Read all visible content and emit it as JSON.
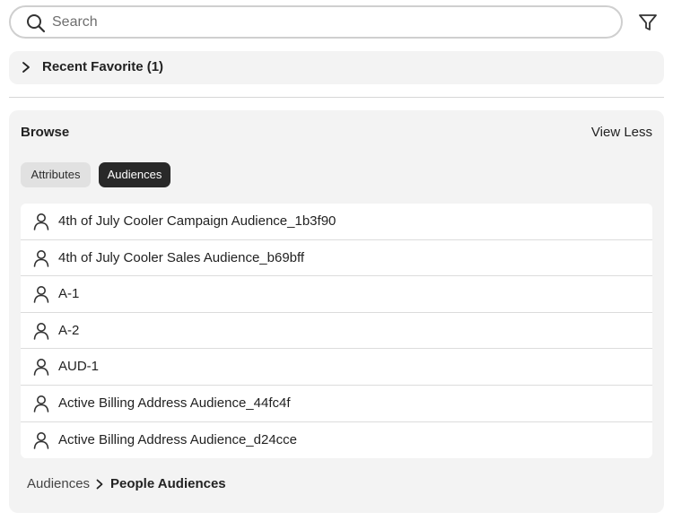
{
  "search": {
    "placeholder": "Search",
    "value": "",
    "icon": "search-icon"
  },
  "filter": {
    "icon": "filter-icon"
  },
  "recent": {
    "label": "Recent Favorite (1)",
    "icon": "chevron-right-icon"
  },
  "browse": {
    "title": "Browse",
    "toggle_label": "View Less",
    "tabs": [
      {
        "label": "Attributes",
        "selected": false
      },
      {
        "label": "Audiences",
        "selected": true
      }
    ],
    "items": [
      {
        "label": "4th of July Cooler Campaign Audience_1b3f90",
        "icon": "user-icon"
      },
      {
        "label": "4th of July Cooler Sales Audience_b69bff",
        "icon": "user-icon"
      },
      {
        "label": "A-1",
        "icon": "user-icon"
      },
      {
        "label": "A-2",
        "icon": "user-icon"
      },
      {
        "label": "AUD-1",
        "icon": "user-icon"
      },
      {
        "label": "Active Billing Address Audience_44fc4f",
        "icon": "user-icon"
      },
      {
        "label": "Active Billing Address Audience_d24cce",
        "icon": "user-icon"
      }
    ],
    "breadcrumb": {
      "root": "Audiences",
      "current": "People Audiences"
    }
  },
  "colors": {
    "panel": "#f3f3f3",
    "selected_tab": "#292929",
    "tab": "#e1e1e1",
    "border": "#cfcfcf"
  }
}
